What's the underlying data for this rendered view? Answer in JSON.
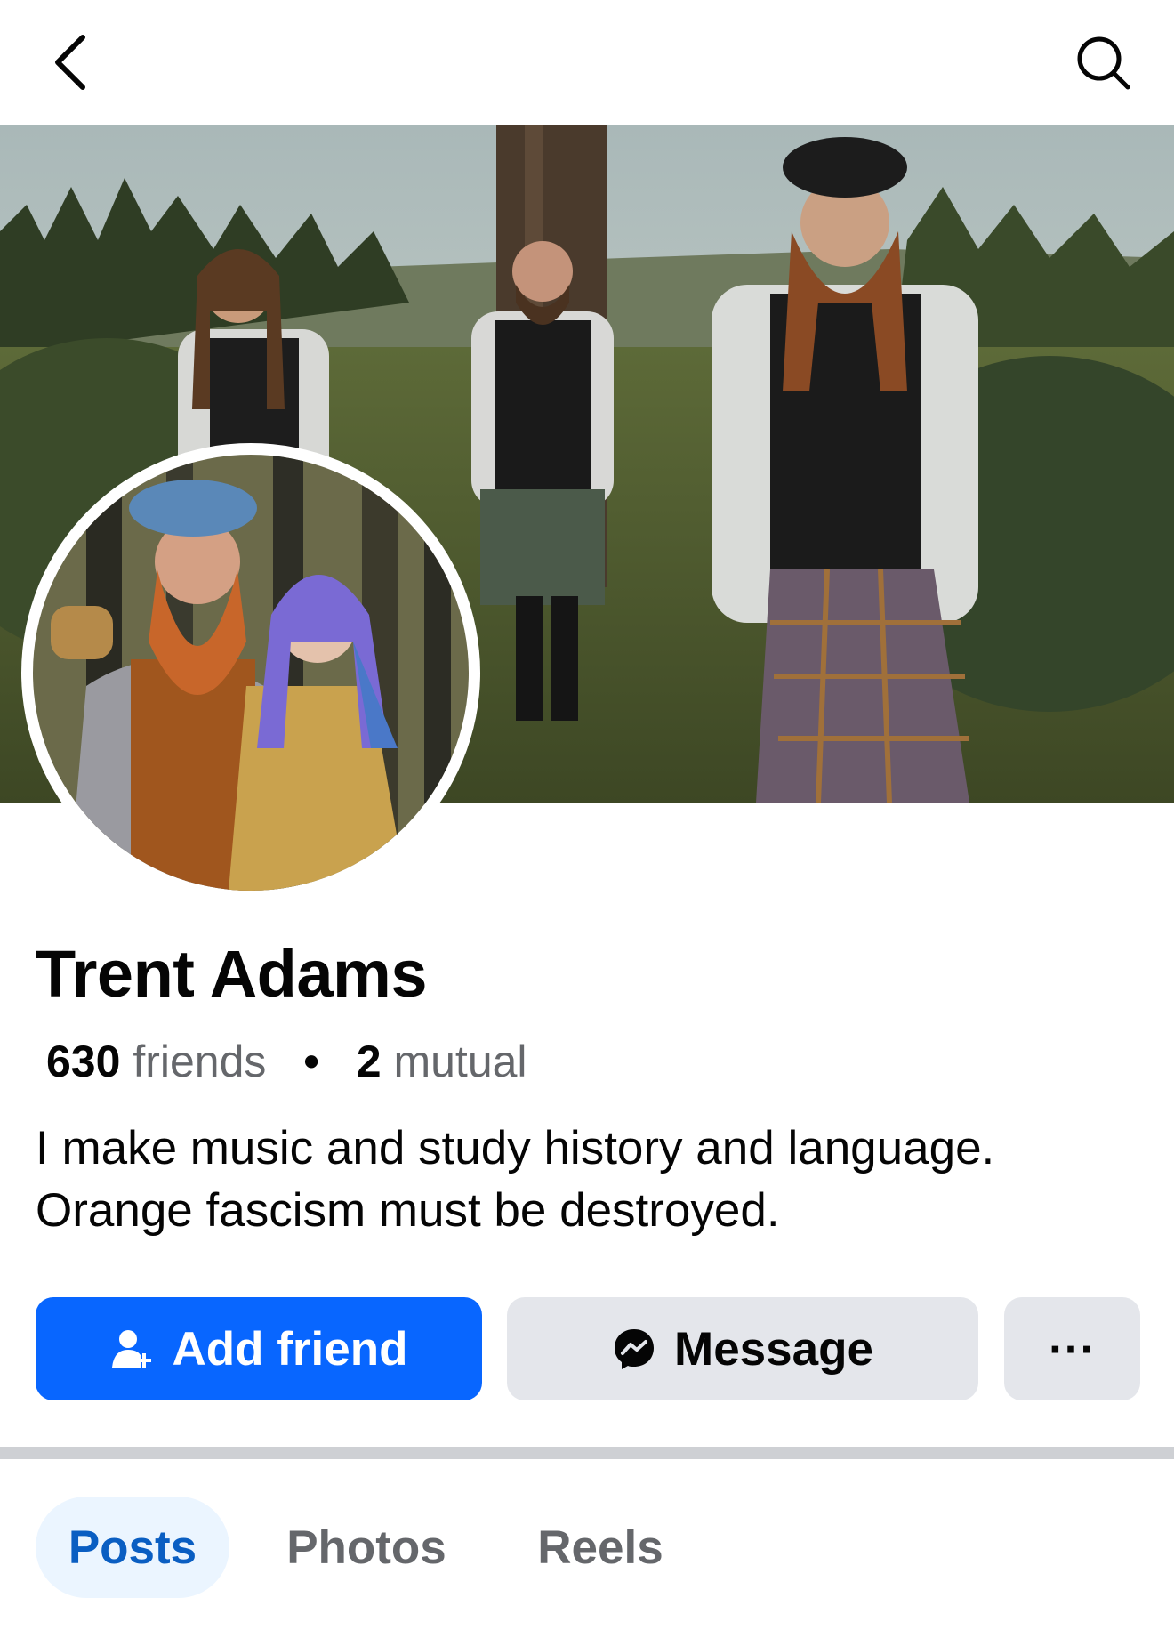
{
  "colors": {
    "accent": "#0866ff",
    "secondary_button": "#e4e6eb",
    "active_tab_bg": "#ebf5ff",
    "active_tab_text": "#0a5ec2",
    "muted_text": "#65676b"
  },
  "icons": {
    "back": "chevron-left-icon",
    "search": "search-icon",
    "add_friend": "person-plus-icon",
    "message": "messenger-icon",
    "more": "more-dots-icon"
  },
  "profile": {
    "name": "Trent Adams",
    "friends_count": "630",
    "friends_label": "friends",
    "separator": "•",
    "mutual_count": "2",
    "mutual_label": "mutual",
    "bio_line1": "I make music and study history and language.",
    "bio_line2": "Orange fascism must be destroyed."
  },
  "actions": {
    "add_friend_label": "Add friend",
    "message_label": "Message",
    "more_label": "···"
  },
  "tabs": [
    {
      "label": "Posts",
      "active": true
    },
    {
      "label": "Photos",
      "active": false
    },
    {
      "label": "Reels",
      "active": false
    }
  ]
}
